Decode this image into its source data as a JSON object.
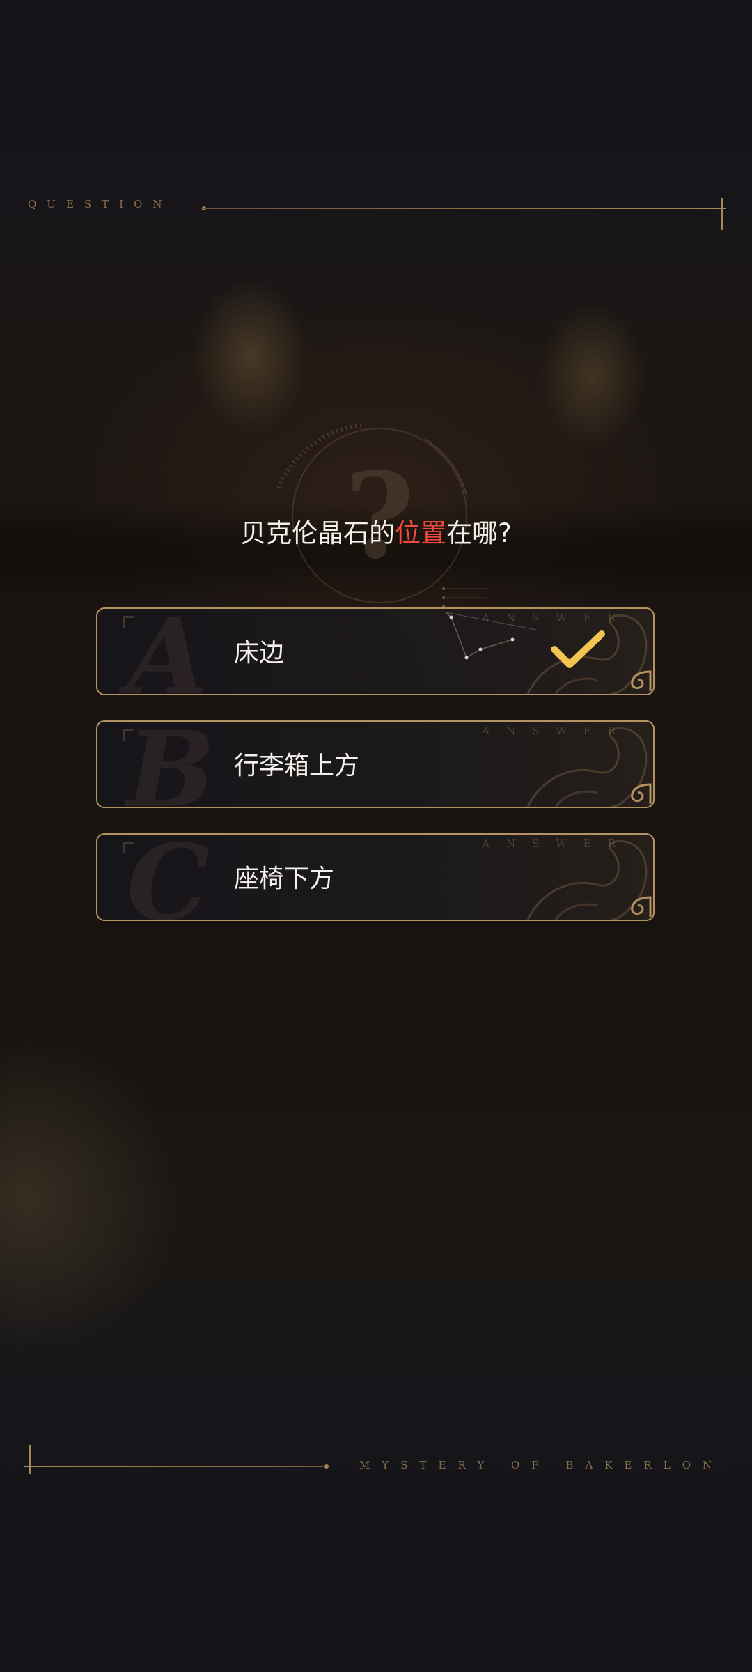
{
  "header": {
    "label": "QUESTION"
  },
  "question": {
    "prefix": "贝克伦晶石的",
    "highlight": "位置",
    "suffix": "在哪?"
  },
  "answers": [
    {
      "letter": "A",
      "text": "床边",
      "tag": "ANSWER",
      "selected": true
    },
    {
      "letter": "B",
      "text": "行李箱上方",
      "tag": "ANSWER",
      "selected": false
    },
    {
      "letter": "C",
      "text": "座椅下方",
      "tag": "ANSWER",
      "selected": false
    }
  ],
  "footer": {
    "label": "MYSTERY OF BAKERLON"
  },
  "colors": {
    "accent": "#b49363",
    "highlight": "#ef4a3e",
    "check": "#f3c44f",
    "background": "#14141a"
  },
  "icons": {
    "check": "check-icon",
    "emblem": "question-mark-emblem-icon"
  }
}
